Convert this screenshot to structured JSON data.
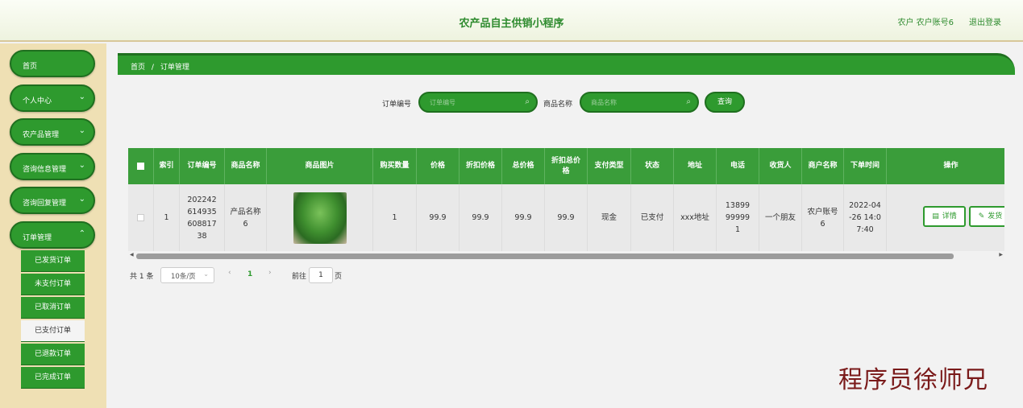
{
  "header": {
    "title": "农产品自主供销小程序",
    "user": "农户 农户账号6",
    "logout": "退出登录"
  },
  "sidebar": {
    "items": [
      {
        "label": "首页",
        "chevron": false
      },
      {
        "label": "个人中心",
        "chevron": true
      },
      {
        "label": "农产品管理",
        "chevron": true
      },
      {
        "label": "咨询信息管理",
        "chevron": true
      },
      {
        "label": "咨询回复管理",
        "chevron": true
      },
      {
        "label": "订单管理",
        "chevron": true
      }
    ],
    "sub_items": [
      "已发货订单",
      "未支付订单",
      "已取消订单",
      "已支付订单",
      "已退款订单",
      "已完成订单"
    ],
    "active_sub": "已支付订单"
  },
  "breadcrumb": {
    "home": "首页",
    "separator": "/",
    "current": "订单管理"
  },
  "search": {
    "order_no_label": "订单编号",
    "order_no_placeholder": "订单编号",
    "product_label": "商品名称",
    "product_placeholder": "商品名称",
    "query_button": "查询"
  },
  "table": {
    "headers": [
      "索引",
      "订单编号",
      "商品名称",
      "商品图片",
      "购买数量",
      "价格",
      "折扣价格",
      "总价格",
      "折扣总价格",
      "支付类型",
      "状态",
      "地址",
      "电话",
      "收货人",
      "商户名称",
      "下单时间",
      "操作"
    ],
    "row": {
      "index": "1",
      "order_no": "20224261493560881738",
      "product_name": "产品名称6",
      "quantity": "1",
      "price": "99.9",
      "discount_price": "99.9",
      "total_price": "99.9",
      "discount_total": "99.9",
      "pay_type": "现金",
      "status": "已支付",
      "address": "xxx地址",
      "phone": "13899999991",
      "receiver": "一个朋友",
      "merchant": "农户账号6",
      "order_time": "2022-04-26 14:07:40",
      "detail_button": "详情",
      "ship_button": "发货"
    }
  },
  "pagination": {
    "total": "共 1 条",
    "page_size": "10条/页",
    "current_page": "1",
    "goto_label": "前往",
    "goto_value": "1",
    "page_unit": "页"
  },
  "watermark": "程序员徐师兄",
  "colors": {
    "primary": "#2e9a2e",
    "sidebar_bg": "#efe0b4",
    "watermark": "#7a1a1a"
  }
}
